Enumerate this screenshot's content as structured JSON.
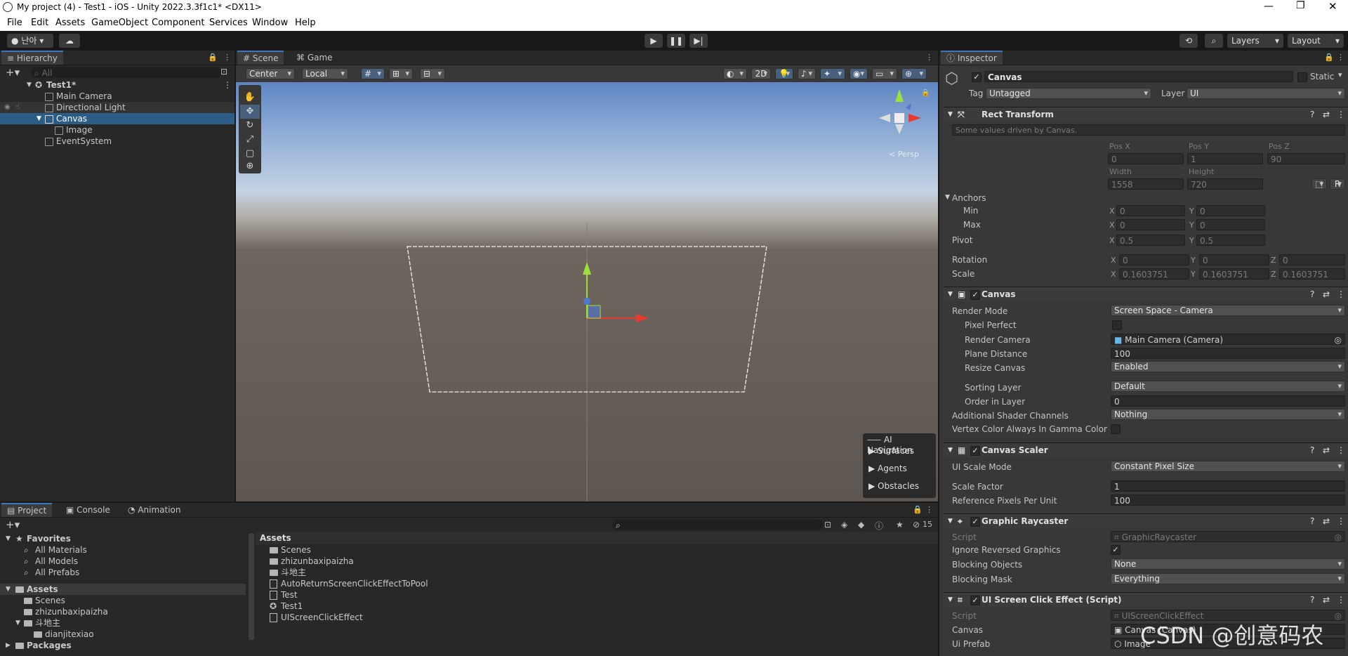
{
  "window": {
    "title": "My project (4) - Test1 - iOS - Unity 2022.3.3f1c1* <DX11>"
  },
  "menu": [
    "File",
    "Edit",
    "Assets",
    "GameObject",
    "Component",
    "Services",
    "Window",
    "Help"
  ],
  "toolbar": {
    "account": "난아",
    "layers": "Layers",
    "layout": "Layout"
  },
  "hierarchy": {
    "tab": "Hierarchy",
    "search_placeholder": "All",
    "items": [
      {
        "label": "Test1*"
      },
      {
        "label": "Main Camera"
      },
      {
        "label": "Directional Light"
      },
      {
        "label": "Canvas"
      },
      {
        "label": "Image"
      },
      {
        "label": "EventSystem"
      }
    ]
  },
  "scene": {
    "tabs": [
      "Scene",
      "Game"
    ],
    "pivot": "Center",
    "space": "Local",
    "mode2d": "2D",
    "persp": "< Persp",
    "overlay": {
      "title": "AI Navigation",
      "items": [
        "Surfaces",
        "Agents",
        "Obstacles"
      ]
    }
  },
  "project": {
    "tabs": [
      "Project",
      "Console",
      "Animation"
    ],
    "count": "15",
    "favorites": {
      "label": "Favorites",
      "items": [
        "All Materials",
        "All Models",
        "All Prefabs"
      ]
    },
    "tree": {
      "assets": "Assets",
      "items": [
        "Scenes",
        "zhizunbaxipaizha",
        "斗地主",
        "dianjitexiao"
      ],
      "packages": "Packages"
    },
    "breadcrumb": "Assets",
    "files": [
      {
        "label": "Scenes",
        "kind": "folder"
      },
      {
        "label": "zhizunbaxipaizha",
        "kind": "folder"
      },
      {
        "label": "斗地主",
        "kind": "folder"
      },
      {
        "label": "AutoReturnScreenClickEffectToPool",
        "kind": "script"
      },
      {
        "label": "Test",
        "kind": "script"
      },
      {
        "label": "Test1",
        "kind": "scene"
      },
      {
        "label": "UIScreenClickEffect",
        "kind": "script"
      }
    ]
  },
  "inspector": {
    "tab": "Inspector",
    "name": "Canvas",
    "static": "Static",
    "tag_label": "Tag",
    "tag": "Untagged",
    "layer_label": "Layer",
    "layer": "UI",
    "rect": {
      "title": "Rect Transform",
      "note": "Some values driven by Canvas.",
      "pos_x_label": "Pos X",
      "pos_y_label": "Pos Y",
      "pos_z_label": "Pos Z",
      "pos_x": "0",
      "pos_y": "1",
      "pos_z": "90",
      "width_label": "Width",
      "height_label": "Height",
      "width": "1558",
      "height": "720",
      "anchors": "Anchors",
      "min": "Min",
      "max": "Max",
      "min_x": "0",
      "min_y": "0",
      "max_x": "0",
      "max_y": "0",
      "pivot": "Pivot",
      "pivot_x": "0.5",
      "pivot_y": "0.5",
      "rotation": "Rotation",
      "rot_x": "0",
      "rot_y": "0",
      "rot_z": "0",
      "scale": "Scale",
      "scale_x": "0.1603751",
      "scale_y": "0.1603751",
      "scale_z": "0.1603751",
      "r_button": "R"
    },
    "canvas": {
      "title": "Canvas",
      "render_mode_label": "Render Mode",
      "render_mode": "Screen Space - Camera",
      "pixel_perfect_label": "Pixel Perfect",
      "render_camera_label": "Render Camera",
      "render_camera": "Main Camera (Camera)",
      "plane_distance_label": "Plane Distance",
      "plane_distance": "100",
      "resize_label": "Resize Canvas",
      "resize": "Enabled",
      "sorting_label": "Sorting Layer",
      "sorting": "Default",
      "order_label": "Order in Layer",
      "order": "0",
      "shader_label": "Additional Shader Channels",
      "shader": "Nothing",
      "vertex_label": "Vertex Color Always In Gamma Color Sp"
    },
    "scaler": {
      "title": "Canvas Scaler",
      "mode_label": "UI Scale Mode",
      "mode": "Constant Pixel Size",
      "factor_label": "Scale Factor",
      "factor": "1",
      "ppu_label": "Reference Pixels Per Unit",
      "ppu": "100"
    },
    "raycaster": {
      "title": "Graphic Raycaster",
      "script_label": "Script",
      "script": "GraphicRaycaster",
      "ignore_label": "Ignore Reversed Graphics",
      "blocking_label": "Blocking Objects",
      "blocking": "None",
      "mask_label": "Blocking Mask",
      "mask": "Everything"
    },
    "click": {
      "title": "UI Screen Click Effect (Script)",
      "script_label": "Script",
      "script": "UIScreenClickEffect",
      "canvas_label": "Canvas",
      "canvas": "Canvas (Canvas)",
      "prefab_label": "Ui Prefab",
      "prefab": "Image"
    }
  },
  "watermark": "CSDN @创意码农"
}
